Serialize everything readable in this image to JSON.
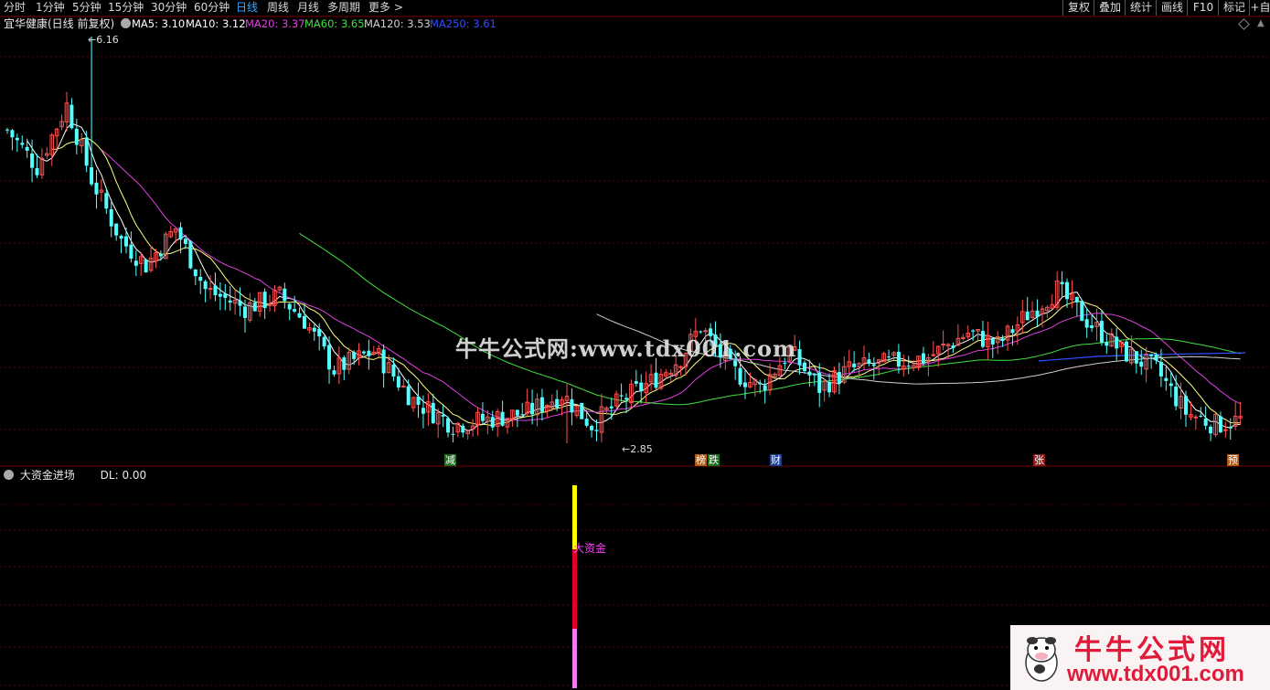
{
  "periods": [
    "分时",
    "1分钟",
    "5分钟",
    "15分钟",
    "30分钟",
    "60分钟",
    "日线",
    "周线",
    "月线",
    "多周期",
    "更多 >"
  ],
  "active_period": "日线",
  "toolbar": [
    "复权",
    "叠加",
    "统计",
    "画线",
    "F10",
    "标记",
    "+自"
  ],
  "stock_title": "宜华健康(日线 前复权)",
  "ma_legend": [
    {
      "label": "MA5: 3.10",
      "color": "#ffffff"
    },
    {
      "label": "MA10: 3.12",
      "color": "#ffffff"
    },
    {
      "label": "MA20: 3.37",
      "color": "#e040e0"
    },
    {
      "label": "MA60: 3.65",
      "color": "#40e040"
    },
    {
      "label": "MA120: 3.53",
      "color": "#d0d0d0"
    },
    {
      "label": "MA250: 3.61",
      "color": "#3050ff"
    }
  ],
  "high_label": "6.16",
  "low_label": "2.85",
  "event_marks": [
    {
      "text": "减",
      "bg": "#1d6b1d",
      "fg": "#ffffff"
    },
    {
      "text": "榜",
      "bg": "#b05a1a",
      "fg": "#ffffff"
    },
    {
      "text": "跌",
      "bg": "#1d6b1d",
      "fg": "#ffffff"
    },
    {
      "text": "财",
      "bg": "#1a3d8f",
      "fg": "#ffffff"
    },
    {
      "text": "张",
      "bg": "#8f1a1a",
      "fg": "#ffffff"
    },
    {
      "text": "预",
      "bg": "#b05a1a",
      "fg": "#ffffff"
    }
  ],
  "watermark": "牛牛公式网:www.tdx001.com",
  "indicator": {
    "name": "大资金进场",
    "dl": "DL: 0.00",
    "bar_label": "大资金"
  },
  "logo": {
    "line1": "牛牛公式网",
    "line2": "www.tdx001.com"
  },
  "colors": {
    "up": "#ff5050",
    "down": "#54ffff",
    "ma5": "#ffffff",
    "ma10": "#ffff80",
    "ma20": "#e040e0",
    "ma60": "#40e040",
    "ma120": "#d0d0d0",
    "ma250": "#3050ff",
    "grid": "#5a0000"
  }
}
